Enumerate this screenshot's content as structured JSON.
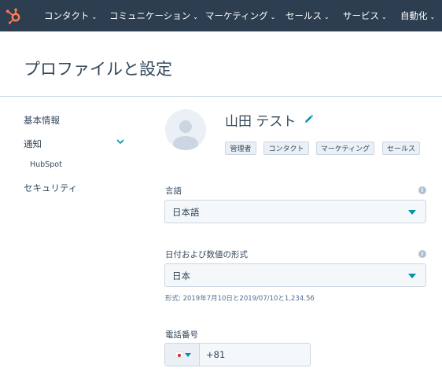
{
  "nav": {
    "logo": "hubspot-sprocket-logo",
    "items": [
      {
        "label": "コンタクト"
      },
      {
        "label": "コミュニケーション"
      },
      {
        "label": "マーケティング"
      },
      {
        "label": "セールス"
      },
      {
        "label": "サービス"
      },
      {
        "label": "自動化"
      }
    ],
    "chevron": "⌄"
  },
  "page": {
    "title": "プロファイルと設定"
  },
  "sidebar": {
    "items": [
      {
        "label": "基本情報"
      },
      {
        "label": "通知",
        "expanded": true
      },
      {
        "label": "HubSpot"
      },
      {
        "label": "セキュリティ"
      }
    ]
  },
  "profile": {
    "name": "山田 テスト",
    "tags": [
      "管理者",
      "コンタクト",
      "マーケティング",
      "セールス"
    ]
  },
  "language": {
    "label": "言語",
    "value": "日本語",
    "info": "i"
  },
  "format": {
    "label": "日付および数値の形式",
    "value": "日本",
    "info": "i",
    "help": "形式: 2019年7月10日と2019/07/10と1,234.56"
  },
  "phone": {
    "label": "電話番号",
    "country_flag": "japan-flag-icon",
    "code": "+81"
  },
  "colors": {
    "nav_bg": "#2d3e50",
    "logo": "#ff7a59",
    "accent": "#0091ae",
    "text": "#33475b",
    "border": "#cbd6e2"
  }
}
